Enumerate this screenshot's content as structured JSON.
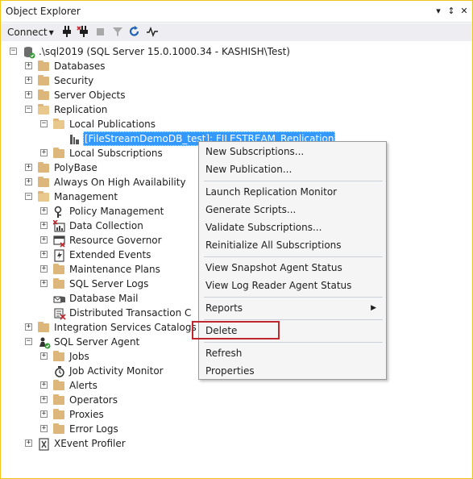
{
  "window": {
    "title": "Object Explorer",
    "controls": [
      "pin-dropdown",
      "pin",
      "close"
    ]
  },
  "toolbar": {
    "connect_label": "Connect",
    "icons": [
      "connect-plug-icon",
      "disconnect-plug-icon",
      "stop-icon",
      "filter-icon",
      "refresh-icon",
      "activity-monitor-icon"
    ]
  },
  "tree": {
    "server": ".\\sql2019 (SQL Server 15.0.1000.34 - KASHISH\\Test)",
    "databases": "Databases",
    "security": "Security",
    "server_objects": "Server Objects",
    "replication": "Replication",
    "local_publications": "Local Publications",
    "publication": "[FileStreamDemoDB_test]: FILESTREAM_Replication",
    "local_subscriptions": "Local Subscriptions",
    "polybase": "PolyBase",
    "always_on": "Always On High Availability",
    "management": "Management",
    "policy_management": "Policy Management",
    "data_collection": "Data Collection",
    "resource_governor": "Resource Governor",
    "extended_events": "Extended Events",
    "maintenance_plans": "Maintenance Plans",
    "sql_server_logs": "SQL Server Logs",
    "database_mail": "Database Mail",
    "dtc": "Distributed Transaction C",
    "integration_services": "Integration Services Catalogs",
    "sql_server_agent": "SQL Server Agent",
    "jobs": "Jobs",
    "job_activity_monitor": "Job Activity Monitor",
    "alerts": "Alerts",
    "operators": "Operators",
    "proxies": "Proxies",
    "error_logs": "Error Logs",
    "xevent_profiler": "XEvent Profiler"
  },
  "context_menu": {
    "new_subscriptions": "New Subscriptions...",
    "new_publication": "New Publication...",
    "launch_replication_monitor": "Launch Replication Monitor",
    "generate_scripts": "Generate Scripts...",
    "validate_subscriptions": "Validate Subscriptions...",
    "reinitialize_all": "Reinitialize All Subscriptions",
    "view_snapshot_agent": "View Snapshot Agent Status",
    "view_log_reader_agent": "View Log Reader Agent Status",
    "reports": "Reports",
    "delete": "Delete",
    "refresh": "Refresh",
    "properties": "Properties"
  },
  "colors": {
    "selection": "#3399ff",
    "highlight_box": "#c0272d",
    "folder": "#dcb67a",
    "window_border": "#f0c419"
  }
}
